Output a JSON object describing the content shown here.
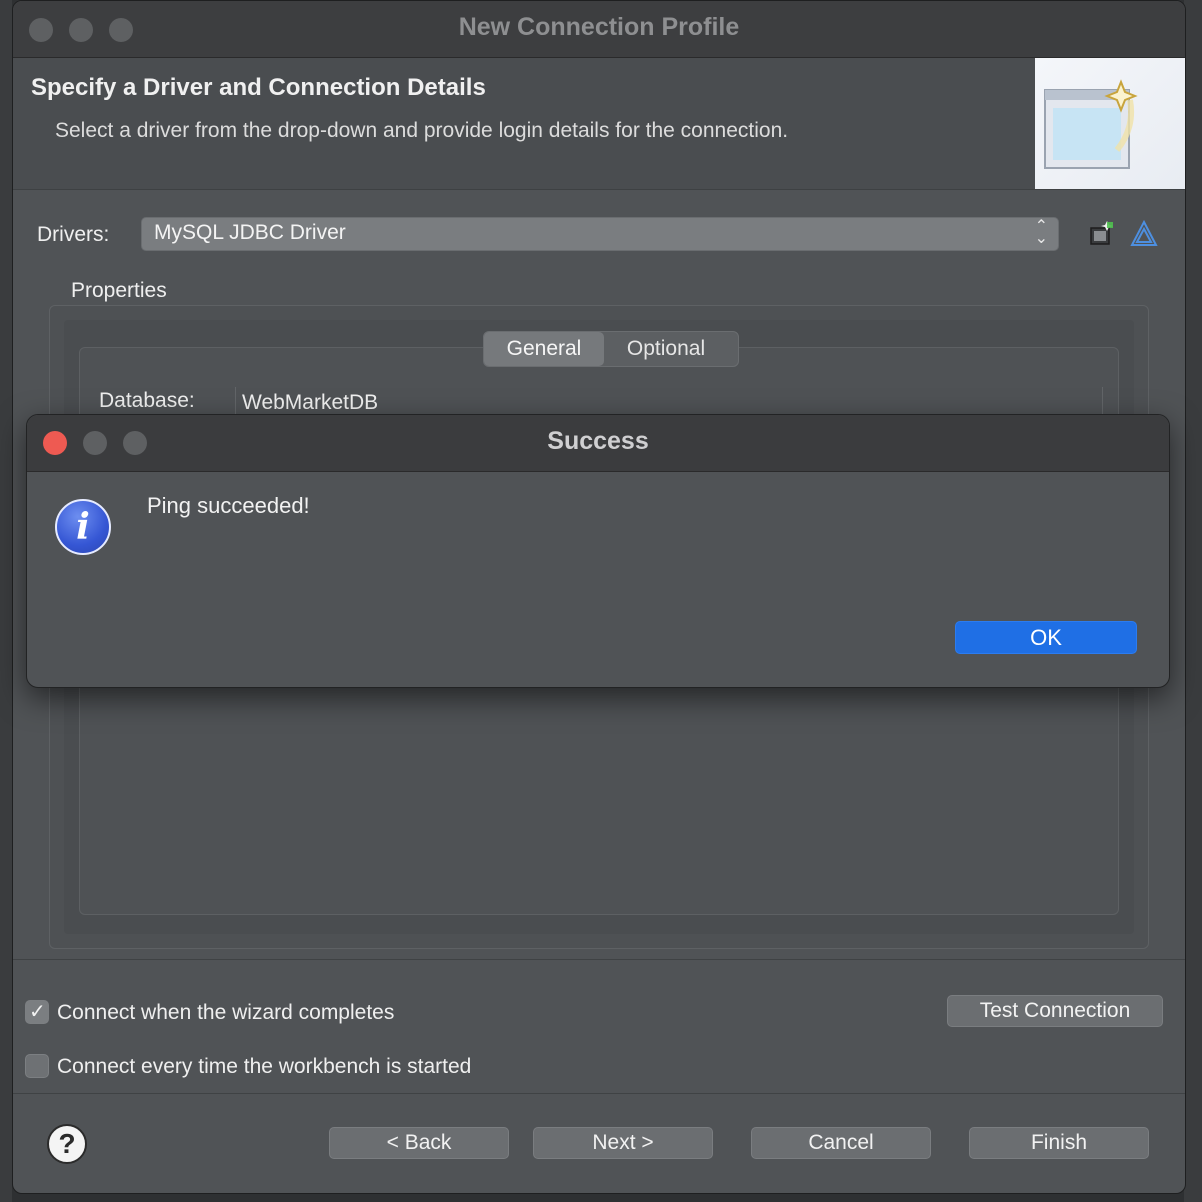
{
  "wizard": {
    "title": "New Connection Profile",
    "header_title": "Specify a Driver and Connection Details",
    "header_description": "Select a driver from the drop-down and provide login details for the connection.",
    "drivers_label": "Drivers:",
    "driver_selected": "MySQL JDBC Driver",
    "properties_label": "Properties",
    "tabs": [
      "General",
      "Optional"
    ],
    "active_tab": "General",
    "database_label": "Database:",
    "database_value": "WebMarketDB",
    "checkbox_connect_on_complete": {
      "label": "Connect when the wizard completes",
      "checked": true
    },
    "checkbox_connect_on_start": {
      "label": "Connect every time the workbench is started",
      "checked": false
    },
    "test_connection_label": "Test Connection",
    "back_label": "< Back",
    "next_label": "Next >",
    "cancel_label": "Cancel",
    "finish_label": "Finish",
    "help_glyph": "?"
  },
  "dialog": {
    "title": "Success",
    "message": "Ping succeeded!",
    "ok_label": "OK",
    "icon": "info-icon",
    "icon_glyph": "i"
  },
  "colors": {
    "ok_button": "#1f6fe5",
    "close_button": "#ee5a52",
    "info_icon": "#3556d4"
  }
}
